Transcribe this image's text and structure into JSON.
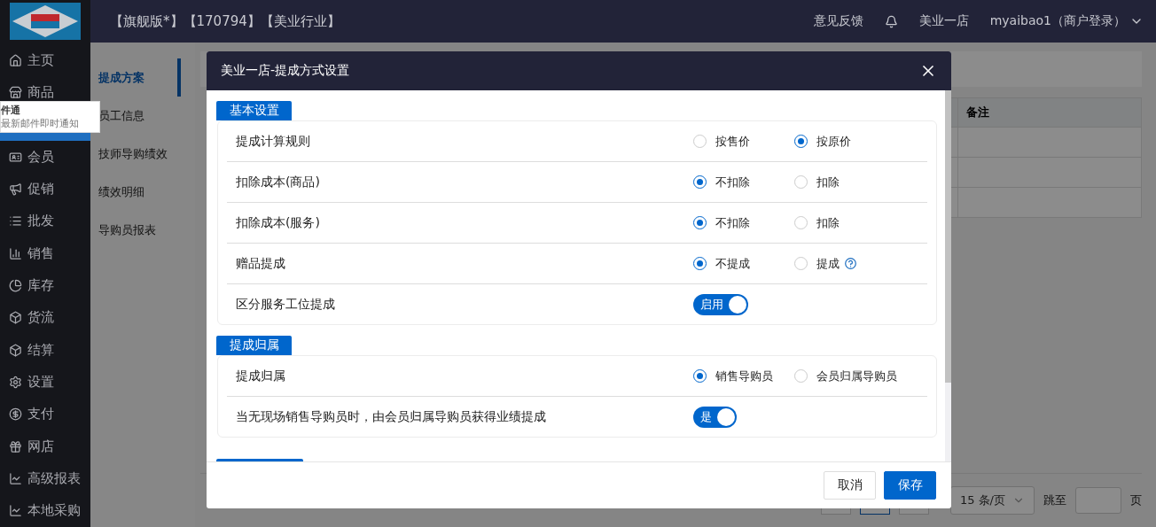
{
  "topbar": {
    "tags": "【旗舰版*】【170794】【美业行业】",
    "feedback": "意见反馈",
    "store": "美业一店",
    "user": "myaibao1（商户登录）"
  },
  "sidebar": {
    "items": [
      {
        "label": "主页",
        "selected": false
      },
      {
        "label": "商品",
        "selected": false
      },
      {
        "selected": true
      },
      {
        "label": "会员",
        "selected": false
      },
      {
        "label": "促销",
        "selected": false
      },
      {
        "label": "批发",
        "selected": false
      },
      {
        "label": "销售",
        "selected": false
      },
      {
        "label": "库存",
        "selected": false
      },
      {
        "label": "货流",
        "selected": false
      },
      {
        "label": "结算",
        "selected": false
      },
      {
        "label": "设置",
        "selected": false
      },
      {
        "label": "支付",
        "selected": false
      },
      {
        "label": "网店",
        "selected": false
      },
      {
        "label": "高级报表",
        "selected": false
      },
      {
        "label": "本地采购",
        "selected": false
      }
    ]
  },
  "tooltip": {
    "title": "件通",
    "text": "最新邮件即时通知"
  },
  "subnav": {
    "items": [
      {
        "label": "提成方案",
        "selected": true
      },
      {
        "label": "员工信息",
        "selected": false
      },
      {
        "label": "技师导购绩效",
        "selected": false
      },
      {
        "label": "绩效明细",
        "selected": false
      },
      {
        "label": "导购员报表",
        "selected": false
      }
    ]
  },
  "table": {
    "columns": [
      "备注"
    ]
  },
  "pagination": {
    "page_size": "15 条/页",
    "jump_label": "跳至",
    "page_label": "页"
  },
  "dialog": {
    "title": "美业一店-提成方式设置",
    "sections": [
      {
        "title": "基本设置",
        "rows": [
          {
            "kind": "radio",
            "label": "提成计算规则",
            "options": [
              {
                "label": "按售价",
                "selected": false
              },
              {
                "label": "按原价",
                "selected": true
              }
            ]
          },
          {
            "kind": "radio",
            "label": "扣除成本(商品)",
            "options": [
              {
                "label": "不扣除",
                "selected": true
              },
              {
                "label": "扣除",
                "selected": false
              }
            ]
          },
          {
            "kind": "radio",
            "label": "扣除成本(服务)",
            "options": [
              {
                "label": "不扣除",
                "selected": true
              },
              {
                "label": "扣除",
                "selected": false
              }
            ]
          },
          {
            "kind": "radio",
            "label": "赠品提成",
            "options": [
              {
                "label": "不提成",
                "selected": true
              },
              {
                "label": "提成",
                "selected": false,
                "help": true
              }
            ]
          },
          {
            "kind": "switch",
            "label": "区分服务工位提成",
            "on": true,
            "switch_label": "启用"
          }
        ]
      },
      {
        "title": "提成归属",
        "rows": [
          {
            "kind": "radio",
            "label": "提成归属",
            "options": [
              {
                "label": "销售导购员",
                "selected": true
              },
              {
                "label": "会员归属导购员",
                "selected": false
              }
            ]
          },
          {
            "kind": "switch",
            "label": "当无现场销售导购员时，由会员归属导购员获得业绩提成",
            "on": true,
            "switch_label": "是"
          }
        ]
      }
    ],
    "buttons": [
      {
        "label": "取消",
        "kind": "secondary"
      },
      {
        "label": "保存",
        "kind": "primary"
      }
    ]
  }
}
